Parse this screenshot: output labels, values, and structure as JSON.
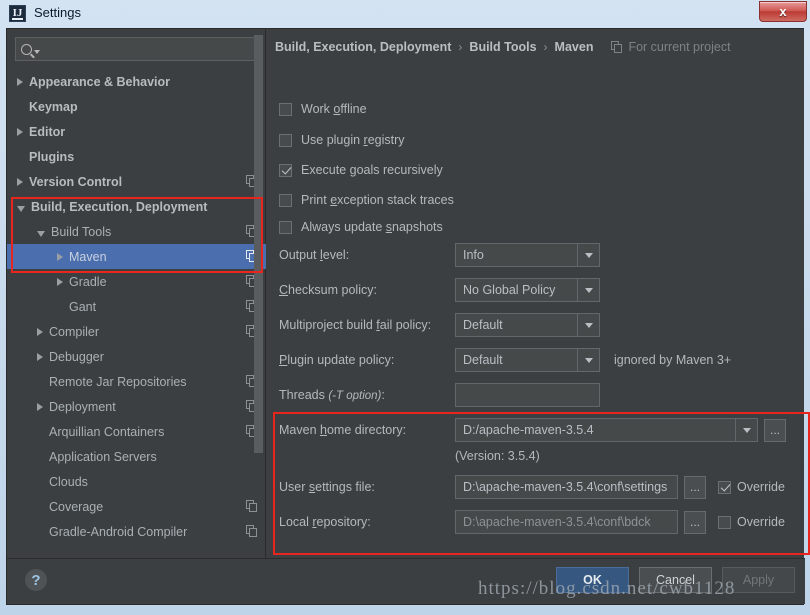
{
  "window": {
    "title": "Settings",
    "icon": "intellij-logo",
    "close_label": "x",
    "accent_selection": "#4b6eaf",
    "highlight_color": "#e8251f",
    "panel_bg": "#3c3f41"
  },
  "sidebar": {
    "search": {
      "placeholder": "",
      "value": "",
      "icon": "search-icon"
    },
    "items": [
      {
        "label": "Appearance & Behavior",
        "indent": 0,
        "arrow": "right",
        "bold": true,
        "project_icon": false,
        "selected": false
      },
      {
        "label": "Keymap",
        "indent": 0,
        "arrow": "none",
        "bold": true,
        "project_icon": false,
        "selected": false
      },
      {
        "label": "Editor",
        "indent": 0,
        "arrow": "right",
        "bold": true,
        "project_icon": false,
        "selected": false
      },
      {
        "label": "Plugins",
        "indent": 0,
        "arrow": "none",
        "bold": true,
        "project_icon": false,
        "selected": false
      },
      {
        "label": "Version Control",
        "indent": 0,
        "arrow": "right",
        "bold": true,
        "project_icon": true,
        "selected": false
      },
      {
        "label": "Build, Execution, Deployment",
        "indent": 0,
        "arrow": "down",
        "bold": true,
        "project_icon": false,
        "selected": false
      },
      {
        "label": "Build Tools",
        "indent": 1,
        "arrow": "down",
        "bold": false,
        "project_icon": true,
        "selected": false
      },
      {
        "label": "Maven",
        "indent": 2,
        "arrow": "right",
        "bold": false,
        "project_icon": true,
        "selected": true
      },
      {
        "label": "Gradle",
        "indent": 2,
        "arrow": "right",
        "bold": false,
        "project_icon": true,
        "selected": false
      },
      {
        "label": "Gant",
        "indent": 2,
        "arrow": "none",
        "bold": false,
        "project_icon": true,
        "selected": false
      },
      {
        "label": "Compiler",
        "indent": 1,
        "arrow": "right",
        "bold": false,
        "project_icon": true,
        "selected": false
      },
      {
        "label": "Debugger",
        "indent": 1,
        "arrow": "right",
        "bold": false,
        "project_icon": false,
        "selected": false
      },
      {
        "label": "Remote Jar Repositories",
        "indent": 1,
        "arrow": "none",
        "bold": false,
        "project_icon": true,
        "selected": false
      },
      {
        "label": "Deployment",
        "indent": 1,
        "arrow": "right",
        "bold": false,
        "project_icon": true,
        "selected": false
      },
      {
        "label": "Arquillian Containers",
        "indent": 1,
        "arrow": "none",
        "bold": false,
        "project_icon": true,
        "selected": false
      },
      {
        "label": "Application Servers",
        "indent": 1,
        "arrow": "none",
        "bold": false,
        "project_icon": false,
        "selected": false
      },
      {
        "label": "Clouds",
        "indent": 1,
        "arrow": "none",
        "bold": false,
        "project_icon": false,
        "selected": false
      },
      {
        "label": "Coverage",
        "indent": 1,
        "arrow": "none",
        "bold": false,
        "project_icon": true,
        "selected": false
      },
      {
        "label": "Gradle-Android Compiler",
        "indent": 1,
        "arrow": "none",
        "bold": false,
        "project_icon": true,
        "selected": false
      }
    ]
  },
  "breadcrumb": {
    "parts": [
      "Build, Execution, Deployment",
      "Build Tools",
      "Maven"
    ],
    "separator": "›",
    "scope_label": "For current project",
    "scope_icon": "project-scope-icon"
  },
  "checkboxes": [
    {
      "label_pre": "Work ",
      "mnemonic": "o",
      "label_post": "ffline",
      "checked": false
    },
    {
      "label_pre": "Use plugin ",
      "mnemonic": "r",
      "label_post": "egistry",
      "checked": false
    },
    {
      "label_pre": "Execute ",
      "mnemonic": "g",
      "label_post": "oals recursively",
      "checked": true
    },
    {
      "label_pre": "Print ",
      "mnemonic": "e",
      "label_post": "xception stack traces",
      "checked": false
    },
    {
      "label_pre": "Always update ",
      "mnemonic": "s",
      "label_post": "napshots",
      "checked": false
    }
  ],
  "fields": {
    "output_level": {
      "label_pre": "Output ",
      "mnemonic": "l",
      "label_post": "evel:",
      "value": "Info"
    },
    "checksum_policy": {
      "label_pre": "",
      "mnemonic": "C",
      "label_post": "hecksum policy:",
      "value": "No Global Policy"
    },
    "multiproject": {
      "label_pre": "Multiproject build ",
      "mnemonic": "f",
      "label_post": "ail policy:",
      "value": "Default"
    },
    "plugin_update": {
      "label_pre": "",
      "mnemonic": "P",
      "label_post": "lugin update policy:",
      "value": "Default",
      "hint": "ignored by Maven 3+"
    },
    "threads": {
      "label_pre": "Threads ",
      "label_italic": "(-T option)",
      "label_post": ":",
      "value": "",
      "placeholder": ""
    }
  },
  "maven_home": {
    "label_pre": "Maven ",
    "mnemonic": "h",
    "label_post": "ome directory:",
    "value": "D:/apache-maven-3.5.4",
    "browse_label": "...",
    "version_note": "(Version: 3.5.4)"
  },
  "user_settings": {
    "label_pre": "User ",
    "mnemonic": "s",
    "label_post": "ettings file:",
    "value": "D:\\apache-maven-3.5.4\\conf\\settings",
    "browse_label": "...",
    "override_label": "Override",
    "override_checked": true
  },
  "local_repository": {
    "label_pre": "Local ",
    "mnemonic": "r",
    "label_post": "epository:",
    "value": "D:\\apache-maven-3.5.4\\conf\\bdck",
    "browse_label": "...",
    "override_label": "Override",
    "override_checked": false
  },
  "footer": {
    "help_label": "?",
    "ok_label": "OK",
    "cancel_label": "Cancel",
    "apply_label": "Apply",
    "apply_disabled": true
  },
  "watermark": "https://blog.csdn.net/cwb1128"
}
